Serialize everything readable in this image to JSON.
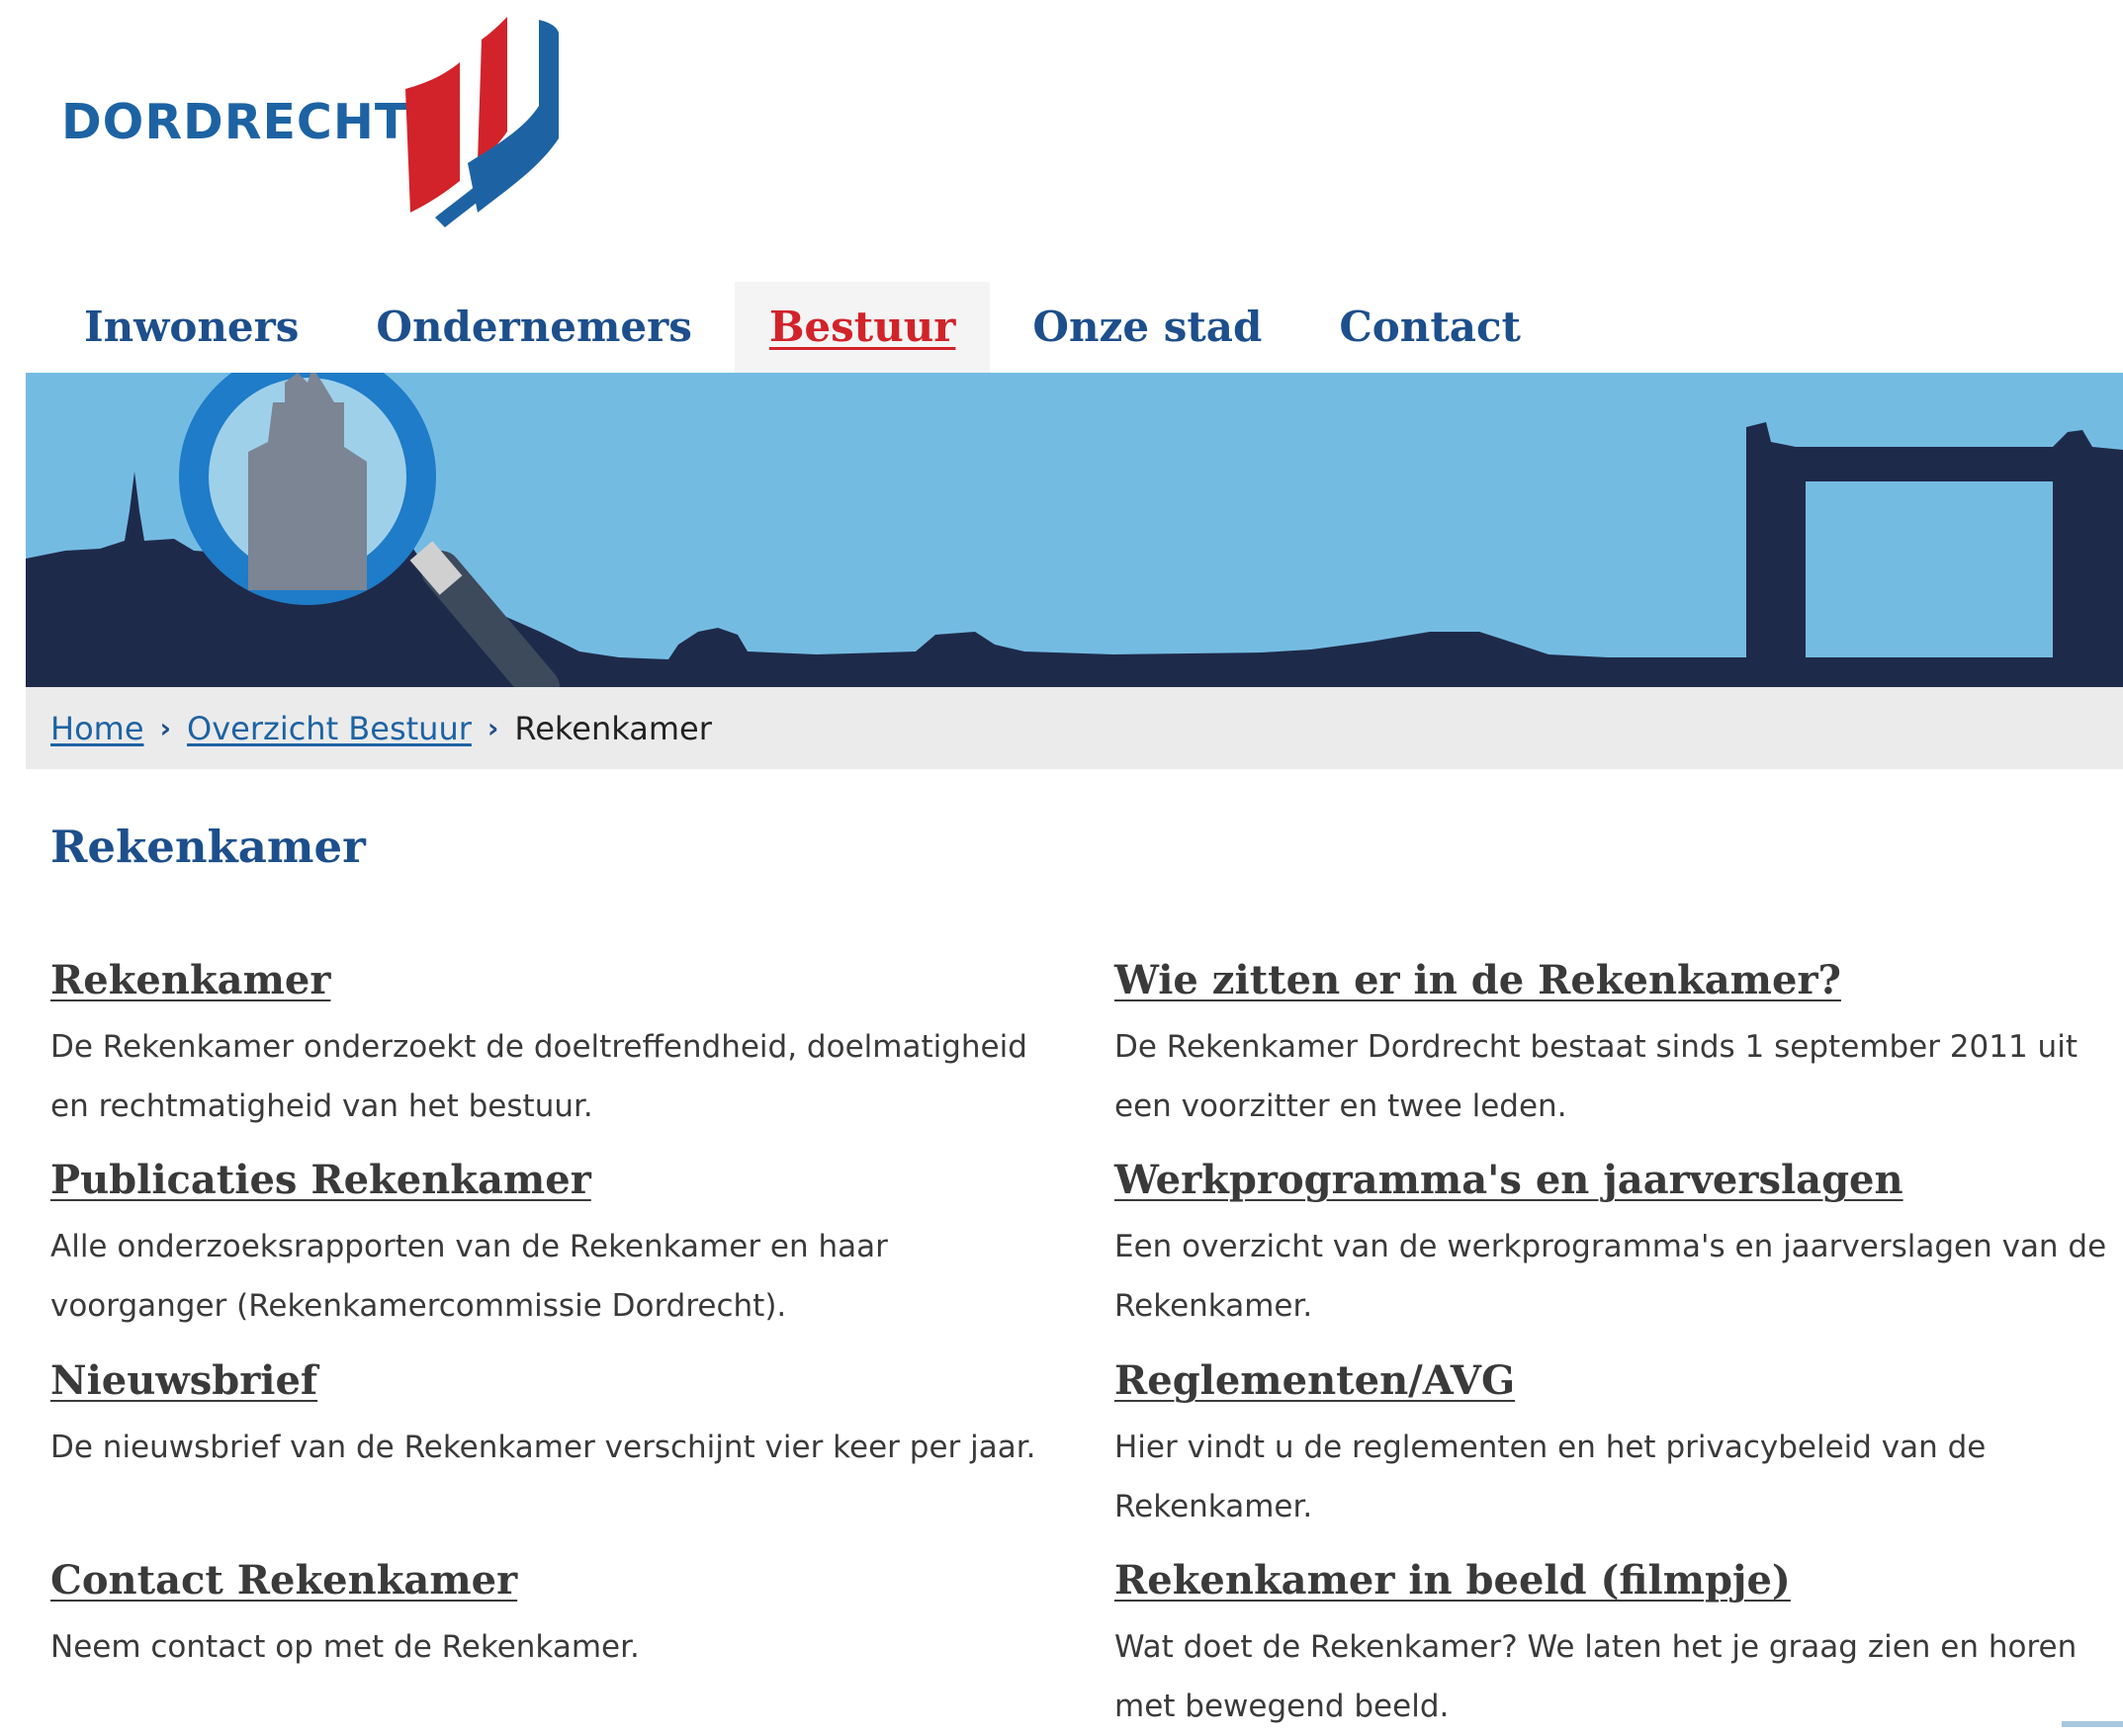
{
  "logo": {
    "text": "DORDRECHT",
    "colors": {
      "blue": "#1d63a3",
      "red": "#d2232a"
    }
  },
  "nav": {
    "items": [
      {
        "label": "Inwoners",
        "active": false
      },
      {
        "label": "Ondernemers",
        "active": false
      },
      {
        "label": "Bestuur",
        "active": true
      },
      {
        "label": "Onze stad",
        "active": false
      },
      {
        "label": "Contact",
        "active": false
      }
    ]
  },
  "banner": {
    "sky_color": "#74bbe2",
    "skyline_color": "#1e2a4a",
    "icon": "magnifying-glass-icon"
  },
  "breadcrumb": {
    "home": "Home",
    "overview": "Overzicht Bestuur",
    "current": "Rekenkamer",
    "separator": "›"
  },
  "page": {
    "title": "Rekenkamer"
  },
  "links": {
    "left": [
      {
        "title": "Rekenkamer",
        "desc_lines": [
          "De Rekenkamer onderzoekt de doeltreffendheid, doelmatigheid",
          "en rechtmatigheid van het bestuur."
        ]
      },
      {
        "title": "Publicaties Rekenkamer",
        "desc_lines": [
          "Alle onderzoeksrapporten van de Rekenkamer en haar",
          "voorganger (Rekenkamercommissie Dordrecht)."
        ]
      },
      {
        "title": "Nieuwsbrief",
        "desc_lines": [
          "De nieuwsbrief van de Rekenkamer verschijnt vier keer per jaar."
        ]
      },
      {
        "title": "Contact Rekenkamer",
        "desc_lines": [
          "Neem contact op met de Rekenkamer."
        ]
      }
    ],
    "right": [
      {
        "title": "Wie zitten er in de Rekenkamer?",
        "desc_lines": [
          "De Rekenkamer Dordrecht bestaat sinds 1 september 2011 uit",
          "een voorzitter en twee leden."
        ]
      },
      {
        "title": "Werkprogramma's en jaarverslagen",
        "desc_lines": [
          "Een overzicht van de werkprogramma's en jaarverslagen van de",
          "Rekenkamer."
        ]
      },
      {
        "title": "Reglementen/AVG",
        "desc_lines": [
          "Hier vindt u de reglementen en het privacybeleid van de",
          "Rekenkamer."
        ]
      },
      {
        "title": "Rekenkamer in beeld (filmpje)",
        "desc_lines": [
          "Wat doet de Rekenkamer? We laten het je graag zien en horen",
          "met bewegend beeld."
        ]
      }
    ]
  }
}
